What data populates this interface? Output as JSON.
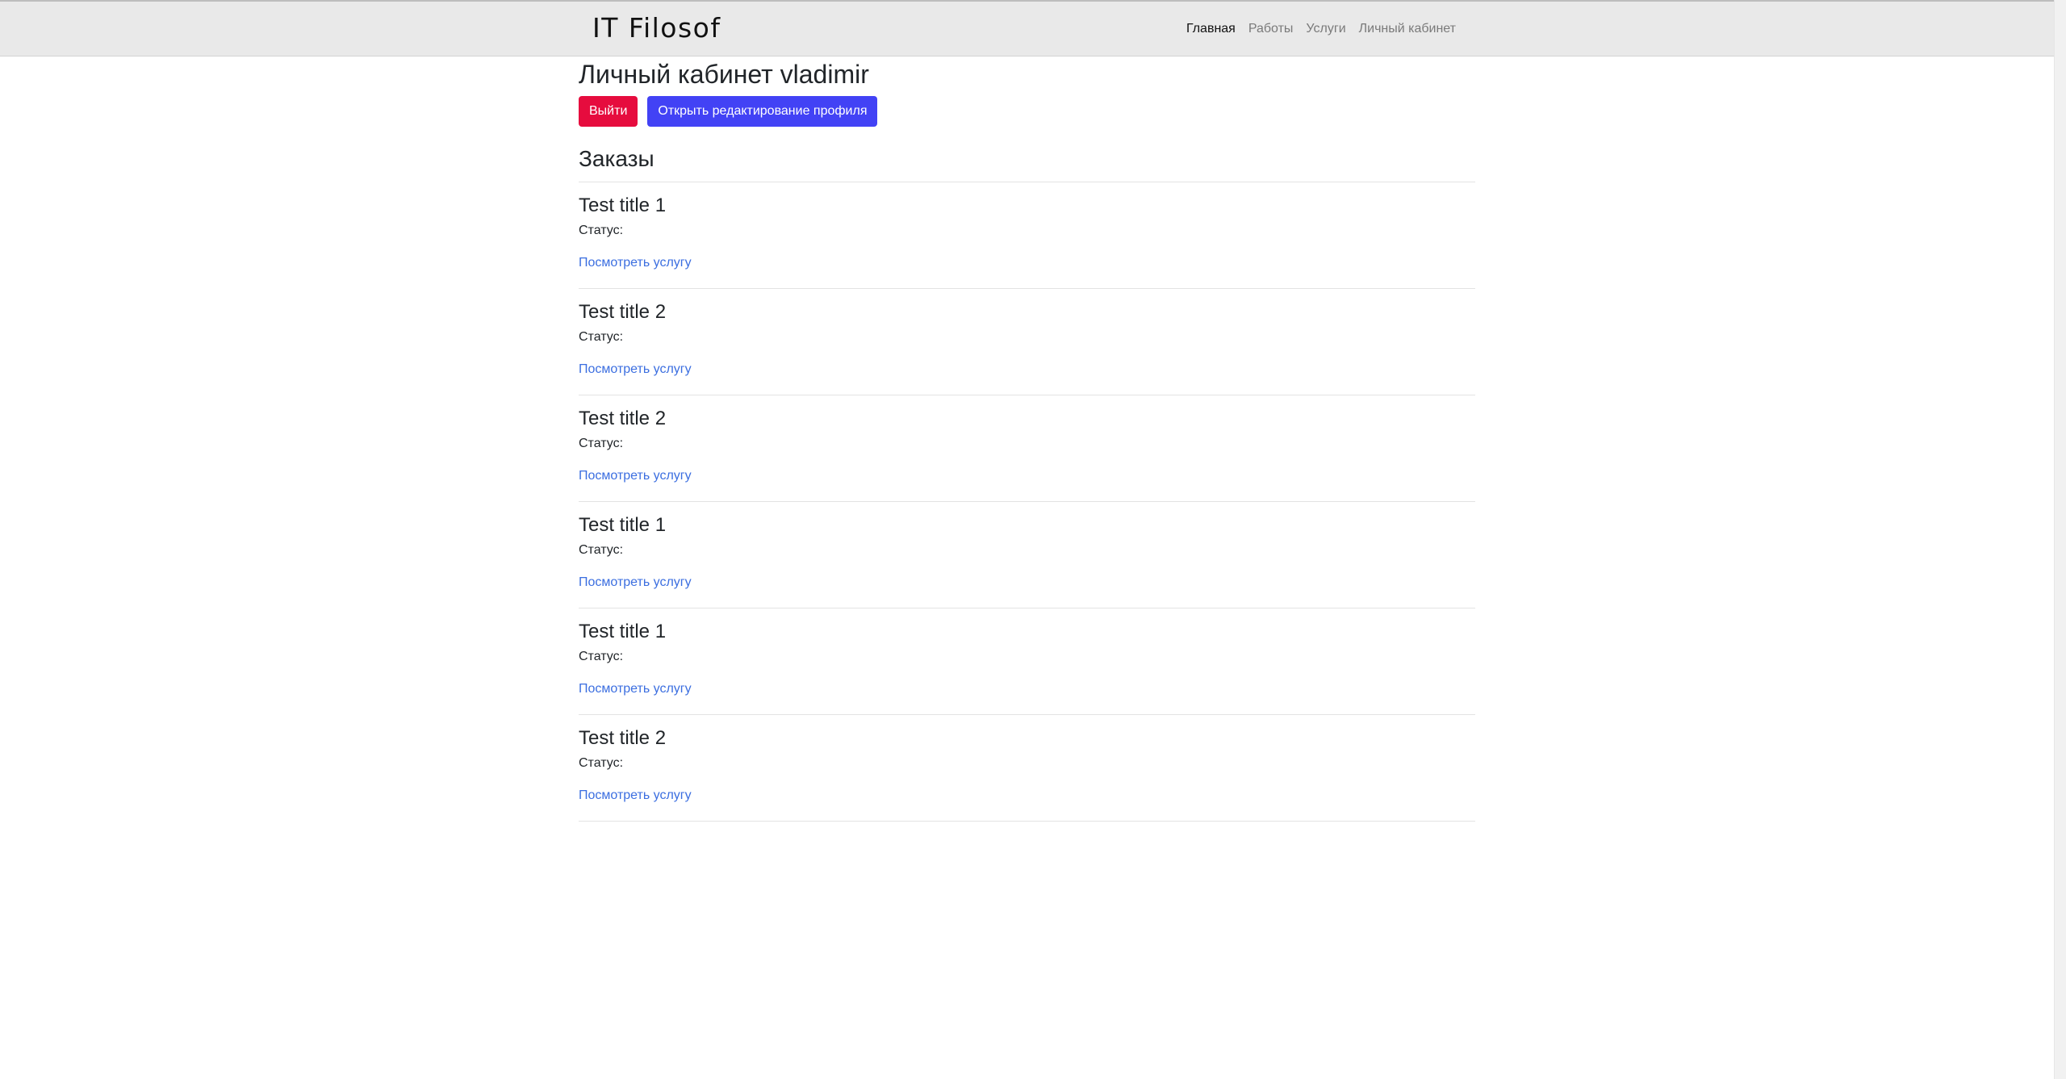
{
  "navbar": {
    "brand": "IT Filosof",
    "links": [
      {
        "label": "Главная",
        "active": true
      },
      {
        "label": "Работы",
        "active": false
      },
      {
        "label": "Услуги",
        "active": false
      },
      {
        "label": "Личный кабинет",
        "active": false
      }
    ]
  },
  "profile": {
    "title": "Личный кабинет vladimir",
    "logout_label": "Выйти",
    "edit_label": "Открыть редактирование профиля"
  },
  "orders": {
    "heading": "Заказы",
    "items": [
      {
        "title": "Test title 1",
        "status": "Статус:",
        "link": "Посмотреть услугу"
      },
      {
        "title": "Test title 2",
        "status": "Статус:",
        "link": "Посмотреть услугу"
      },
      {
        "title": "Test title 2",
        "status": "Статус:",
        "link": "Посмотреть услугу"
      },
      {
        "title": "Test title 1",
        "status": "Статус:",
        "link": "Посмотреть услугу"
      },
      {
        "title": "Test title 1",
        "status": "Статус:",
        "link": "Посмотреть услугу"
      },
      {
        "title": "Test title 2",
        "status": "Статус:",
        "link": "Посмотреть услугу"
      }
    ]
  },
  "colors": {
    "navbar_bg": "#e9e9e9",
    "logout_button": "#e60c3e",
    "edit_button": "#4242f5",
    "link": "#3b6ee0"
  }
}
